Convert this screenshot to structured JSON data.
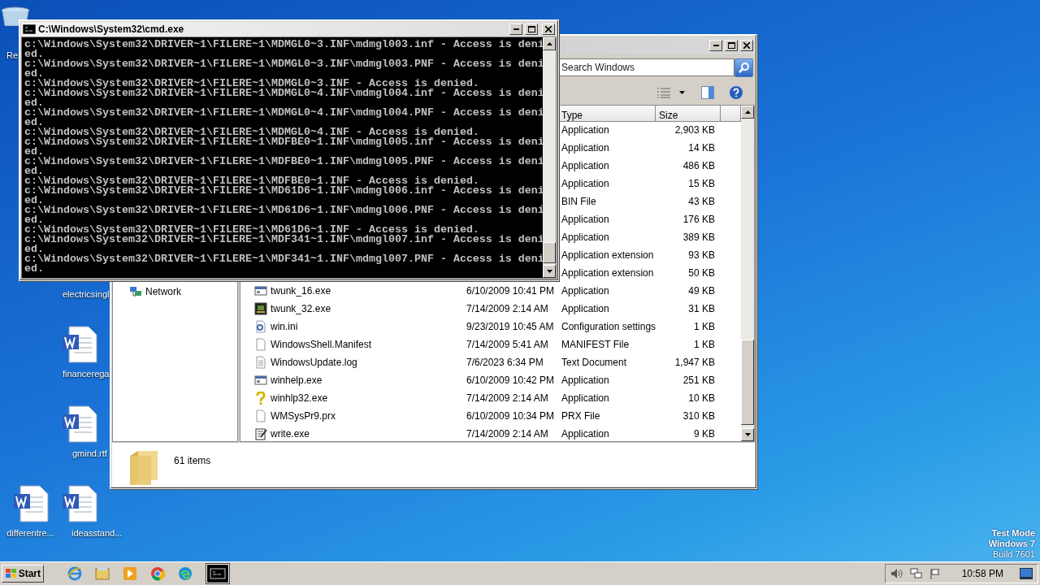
{
  "desktop_icons": [
    {
      "label": "Re",
      "kind": "recycle"
    },
    {
      "label": "electricsingl"
    },
    {
      "label": "financerega",
      "kind": "word"
    },
    {
      "label": "gmind.rtf",
      "kind": "word"
    },
    {
      "label": "differentre...",
      "kind": "word"
    },
    {
      "label": "ideasstand...",
      "kind": "word"
    }
  ],
  "explorer": {
    "search": {
      "placeholder": "Search Windows"
    },
    "navigation": [
      {
        "label": "Network"
      }
    ],
    "columns": [
      {
        "label": "Type"
      },
      {
        "label": "Size"
      }
    ],
    "rows": [
      {
        "type": "Application",
        "size": "2,903 KB"
      },
      {
        "type": "Application",
        "size": "14 KB"
      },
      {
        "type": "Application",
        "size": "486 KB"
      },
      {
        "type": "Application",
        "size": "15 KB"
      },
      {
        "type": "BIN File",
        "size": "43 KB"
      },
      {
        "type": "Application",
        "size": "176 KB"
      },
      {
        "type": "Application",
        "size": "389 KB"
      },
      {
        "type": "Application extension",
        "size": "93 KB"
      },
      {
        "type": "Application extension",
        "size": "50 KB"
      },
      {
        "kind": "app",
        "name": "twunk_16.exe",
        "date": "6/10/2009 10:41 PM",
        "type": "Application",
        "size": "49 KB"
      },
      {
        "kind": "app-dark",
        "name": "twunk_32.exe",
        "date": "7/14/2009 2:14 AM",
        "type": "Application",
        "size": "31 KB"
      },
      {
        "kind": "settings",
        "name": "win.ini",
        "date": "9/23/2019 10:45 AM",
        "type": "Configuration settings",
        "size": "1 KB"
      },
      {
        "kind": "file",
        "name": "WindowsShell.Manifest",
        "date": "7/14/2009 5:41 AM",
        "type": "MANIFEST File",
        "size": "1 KB"
      },
      {
        "kind": "text",
        "name": "WindowsUpdate.log",
        "date": "7/6/2023 6:34 PM",
        "type": "Text Document",
        "size": "1,947 KB"
      },
      {
        "kind": "app",
        "name": "winhelp.exe",
        "date": "6/10/2009 10:42 PM",
        "type": "Application",
        "size": "251 KB"
      },
      {
        "kind": "help",
        "name": "winhlp32.exe",
        "date": "7/14/2009 2:14 AM",
        "type": "Application",
        "size": "10 KB"
      },
      {
        "kind": "file",
        "name": "WMSysPr9.prx",
        "date": "6/10/2009 10:34 PM",
        "type": "PRX File",
        "size": "310 KB"
      },
      {
        "kind": "write",
        "name": "write.exe",
        "date": "7/14/2009 2:14 AM",
        "type": "Application",
        "size": "9 KB"
      }
    ],
    "status": "61 items"
  },
  "console": {
    "title": "C:\\Windows\\System32\\cmd.exe",
    "lines": [
      "c:\\Windows\\System32\\DRIVER~1\\FILERE~1\\MDMGL0~3.INF\\mdmgl003.inf - Access is deni",
      "ed.",
      "c:\\Windows\\System32\\DRIVER~1\\FILERE~1\\MDMGL0~3.INF\\mdmgl003.PNF - Access is deni",
      "ed.",
      "c:\\Windows\\System32\\DRIVER~1\\FILERE~1\\MDMGL0~3.INF - Access is denied.",
      "c:\\Windows\\System32\\DRIVER~1\\FILERE~1\\MDMGL0~4.INF\\mdmgl004.inf - Access is deni",
      "ed.",
      "c:\\Windows\\System32\\DRIVER~1\\FILERE~1\\MDMGL0~4.INF\\mdmgl004.PNF - Access is deni",
      "ed.",
      "c:\\Windows\\System32\\DRIVER~1\\FILERE~1\\MDMGL0~4.INF - Access is denied.",
      "c:\\Windows\\System32\\DRIVER~1\\FILERE~1\\MDFBE0~1.INF\\mdmgl005.inf - Access is deni",
      "ed.",
      "c:\\Windows\\System32\\DRIVER~1\\FILERE~1\\MDFBE0~1.INF\\mdmgl005.PNF - Access is deni",
      "ed.",
      "c:\\Windows\\System32\\DRIVER~1\\FILERE~1\\MDFBE0~1.INF - Access is denied.",
      "c:\\Windows\\System32\\DRIVER~1\\FILERE~1\\MD61D6~1.INF\\mdmgl006.inf - Access is deni",
      "ed.",
      "c:\\Windows\\System32\\DRIVER~1\\FILERE~1\\MD61D6~1.INF\\mdmgl006.PNF - Access is deni",
      "ed.",
      "c:\\Windows\\System32\\DRIVER~1\\FILERE~1\\MD61D6~1.INF - Access is denied.",
      "c:\\Windows\\System32\\DRIVER~1\\FILERE~1\\MDF341~1.INF\\mdmgl007.inf - Access is deni",
      "ed.",
      "c:\\Windows\\System32\\DRIVER~1\\FILERE~1\\MDF341~1.INF\\mdmgl007.PNF - Access is deni",
      "ed."
    ]
  },
  "system_info": [
    "Test Mode",
    "Windows 7",
    "Build 7601"
  ],
  "taskbar": {
    "start": "Start",
    "apps": [
      {
        "kind": "ie",
        "selected": false
      },
      {
        "kind": "folder",
        "selected": false
      },
      {
        "kind": "media",
        "selected": false
      },
      {
        "kind": "chrome",
        "selected": false
      },
      {
        "kind": "edge",
        "selected": false
      },
      {
        "kind": "console",
        "selected": true
      }
    ],
    "clock": "10:58 PM"
  }
}
